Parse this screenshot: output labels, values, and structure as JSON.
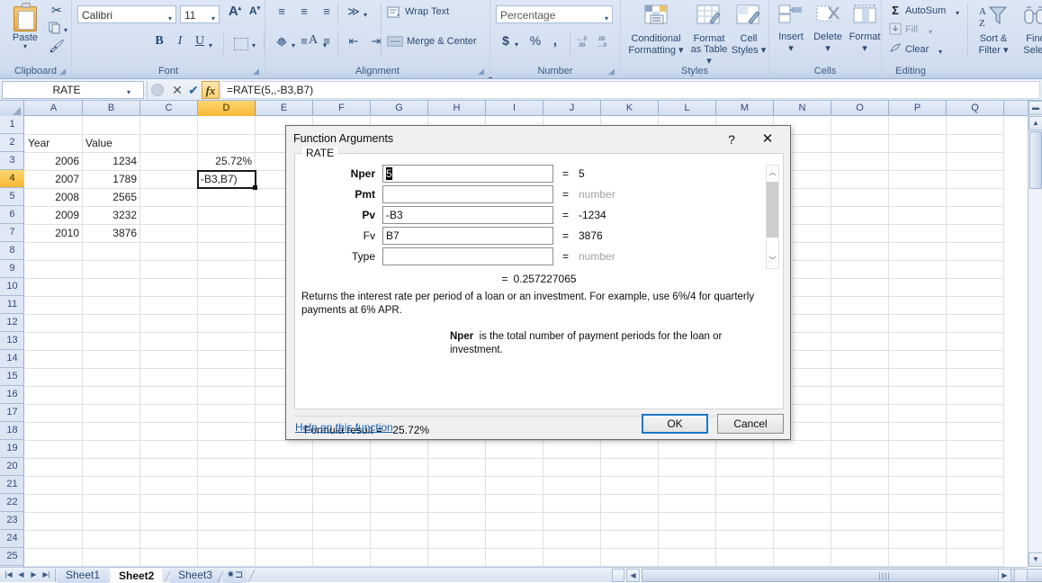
{
  "ribbon": {
    "groups": {
      "clipboard": {
        "label": "Clipboard",
        "paste_label": "Paste",
        "paste_icon": "paste-icon",
        "cut_icon": "scissors-icon",
        "copy_icon": "copy-icon",
        "format_painter_icon": "format-painter-icon",
        "launcher_icon": "dialog-launcher-icon"
      },
      "font": {
        "label": "Font",
        "font_name": "Calibri",
        "font_size": "11",
        "grow_font_icon": "grow-font-icon",
        "shrink_font_icon": "shrink-font-icon",
        "bold_label": "B",
        "italic_label": "I",
        "underline_label": "U",
        "borders_icon": "borders-icon",
        "fill_color_icon": "fill-color-icon",
        "font_color_label": "A",
        "launcher_icon": "dialog-launcher-icon"
      },
      "alignment": {
        "label": "Alignment",
        "wrap_text_label": "Wrap Text",
        "merge_center_label": "Merge & Center",
        "top_align_icon": "align-top-icon",
        "middle_align_icon": "align-middle-icon",
        "bottom_align_icon": "align-bottom-icon",
        "left_align_icon": "align-left-icon",
        "center_align_icon": "align-center-icon",
        "right_align_icon": "align-right-icon",
        "orientation_icon": "orientation-icon",
        "decrease_indent_icon": "decrease-indent-icon",
        "increase_indent_icon": "increase-indent-icon",
        "launcher_icon": "dialog-launcher-icon"
      },
      "number": {
        "label": "Number",
        "format_value": "Percentage",
        "accounting_label": "$",
        "percent_label": "%",
        "comma_label": ",",
        "increase_decimal_icon": "increase-decimal-icon",
        "decrease_decimal_icon": "decrease-decimal-icon",
        "launcher_icon": "dialog-launcher-icon"
      },
      "styles": {
        "label": "Styles",
        "items": [
          {
            "label_line1": "Conditional",
            "label_line2": "Formatting",
            "icon": "conditional-formatting-icon"
          },
          {
            "label_line1": "Format",
            "label_line2": "as Table",
            "icon": "format-as-table-icon"
          },
          {
            "label_line1": "Cell",
            "label_line2": "Styles",
            "icon": "cell-styles-icon"
          }
        ]
      },
      "cells": {
        "label": "Cells",
        "items": [
          {
            "label": "Insert",
            "icon": "insert-cells-icon"
          },
          {
            "label": "Delete",
            "icon": "delete-cells-icon"
          },
          {
            "label": "Format",
            "icon": "format-cells-icon"
          }
        ]
      },
      "editing": {
        "label": "Editing",
        "autosum_label": "AutoSum",
        "autosum_icon": "sigma-icon",
        "fill_label": "Fill",
        "fill_icon": "fill-down-icon",
        "clear_label": "Clear",
        "clear_icon": "eraser-icon",
        "sort_filter_line1": "Sort &",
        "sort_filter_line2": "Filter",
        "sort_filter_icon": "sort-filter-icon",
        "find_select_line1": "Find",
        "find_select_line2": "Selec",
        "find_select_icon": "binoculars-icon"
      }
    }
  },
  "formula_bar": {
    "name_box_value": "RATE",
    "name_box_caret_icon": "chevron-down-icon",
    "insert_function_icon": "insert-function-icon",
    "cancel_icon": "cancel-x-icon",
    "enter_icon": "enter-check-icon",
    "fx_label": "fx",
    "formula_value": "=RATE(5,,-B3,B7)"
  },
  "grid": {
    "columns": [
      "A",
      "B",
      "C",
      "D",
      "E",
      "F",
      "G",
      "H",
      "I",
      "J",
      "K",
      "L",
      "M",
      "N",
      "O",
      "P",
      "Q"
    ],
    "selected_column": "D",
    "rows": [
      1,
      2,
      3,
      4,
      5,
      6,
      7,
      8,
      9,
      10,
      11,
      12,
      13,
      14,
      15,
      16,
      17,
      18,
      19,
      20,
      21,
      22,
      23,
      24,
      25
    ],
    "selected_row": 4,
    "cells": [
      {
        "col": 0,
        "row": 2,
        "value": "Year",
        "align": "left"
      },
      {
        "col": 1,
        "row": 2,
        "value": "Value",
        "align": "left"
      },
      {
        "col": 0,
        "row": 3,
        "value": "2006",
        "align": "right"
      },
      {
        "col": 1,
        "row": 3,
        "value": "1234",
        "align": "right"
      },
      {
        "col": 0,
        "row": 4,
        "value": "2007",
        "align": "right"
      },
      {
        "col": 1,
        "row": 4,
        "value": "1789",
        "align": "right"
      },
      {
        "col": 0,
        "row": 5,
        "value": "2008",
        "align": "right"
      },
      {
        "col": 1,
        "row": 5,
        "value": "2565",
        "align": "right"
      },
      {
        "col": 0,
        "row": 6,
        "value": "2009",
        "align": "right"
      },
      {
        "col": 1,
        "row": 6,
        "value": "3232",
        "align": "right"
      },
      {
        "col": 0,
        "row": 7,
        "value": "2010",
        "align": "right"
      },
      {
        "col": 1,
        "row": 7,
        "value": "3876",
        "align": "right"
      },
      {
        "col": 3,
        "row": 3,
        "value": "25.72%",
        "align": "right"
      }
    ],
    "active_cell": {
      "col": 3,
      "row": 4,
      "editing_text": "-B3,B7)"
    }
  },
  "scrollbars": {
    "vertical_split_icon": "split-handle-icon",
    "up_icon": "arrow-up-icon",
    "down_icon": "arrow-down-icon",
    "left_icon": "arrow-left-icon",
    "right_icon": "arrow-right-icon",
    "thumb_grip_icon": "grip-icon"
  },
  "sheet_tabs": {
    "first_icon": "nav-first-icon",
    "prev_icon": "nav-prev-icon",
    "next_icon": "nav-next-icon",
    "last_icon": "nav-last-icon",
    "tabs": [
      {
        "label": "Sheet1",
        "active": false
      },
      {
        "label": "Sheet2",
        "active": true
      },
      {
        "label": "Sheet3",
        "active": false
      }
    ],
    "new_sheet_icon": "new-sheet-icon"
  },
  "dialog": {
    "title": "Function Arguments",
    "help_label": "?",
    "close_label": "✕",
    "function_name": "RATE",
    "arguments": [
      {
        "label": "Nper",
        "value": "5",
        "required": true,
        "selected": true,
        "result": "5",
        "is_placeholder": false,
        "collapse_icon": "range-selector-icon"
      },
      {
        "label": "Pmt",
        "value": "",
        "required": true,
        "selected": false,
        "result": "number",
        "is_placeholder": true,
        "collapse_icon": "range-selector-icon"
      },
      {
        "label": "Pv",
        "value": "-B3",
        "required": true,
        "selected": false,
        "result": "-1234",
        "is_placeholder": false,
        "collapse_icon": "range-selector-icon"
      },
      {
        "label": "Fv",
        "value": "B7",
        "required": false,
        "selected": false,
        "result": "3876",
        "is_placeholder": false,
        "collapse_icon": "range-selector-icon"
      },
      {
        "label": "Type",
        "value": "",
        "required": false,
        "selected": false,
        "result": "number",
        "is_placeholder": true,
        "collapse_icon": "range-selector-icon"
      }
    ],
    "equals_symbol": "=",
    "evaluated_result": "0.257227065",
    "description": "Returns the interest rate per period of a loan or an investment. For example, use 6%/4 for quarterly payments at 6% APR.",
    "arg_description_name": "Nper",
    "arg_description_text": "is the total number of payment periods for the loan or investment.",
    "formula_result_label": "Formula result =",
    "formula_result_value": "25.72%",
    "help_link_label": "Help on this function",
    "ok_label": "OK",
    "cancel_label": "Cancel"
  },
  "colors": {
    "ribbon_bg": "#d6e1f1",
    "selection_amber": "#f6b836",
    "focus_blue": "#1978c8",
    "link_blue": "#1a5fb4",
    "grid_line": "#e0e0e0"
  }
}
